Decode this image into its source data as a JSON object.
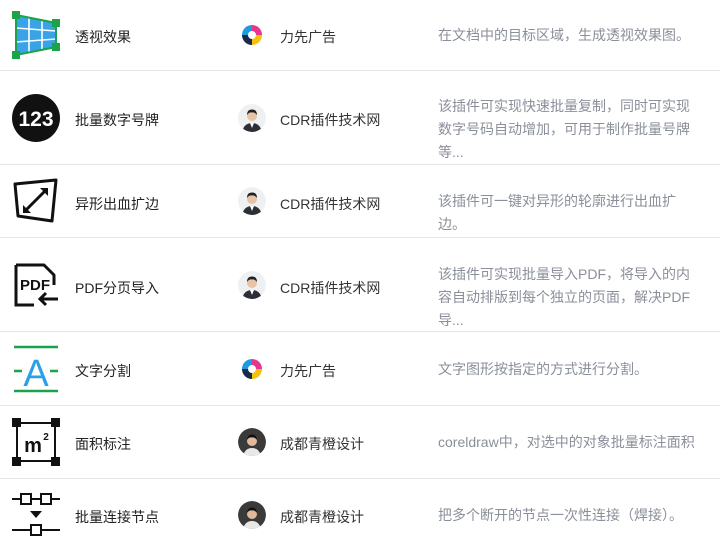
{
  "plugins": [
    {
      "icon": "perspective-grid-icon",
      "name": "透视效果",
      "author": "力先广告",
      "avatar": "logo-avatar",
      "desc": "在文档中的目标区域，生成透视效果图。"
    },
    {
      "icon": "number-123-icon",
      "name": "批量数字号牌",
      "author": "CDR插件技术网",
      "avatar": "person-avatar",
      "desc": "该插件可实现快速批量复制，同时可实现数字号码自动增加，可用于制作批量号牌等..."
    },
    {
      "icon": "bleed-expand-icon",
      "name": "异形出血扩边",
      "author": "CDR插件技术网",
      "avatar": "person-avatar",
      "desc": "该插件可一键对异形的轮廓进行出血扩边。"
    },
    {
      "icon": "pdf-import-icon",
      "name": "PDF分页导入",
      "author": "CDR插件技术网",
      "avatar": "person-avatar",
      "desc": "该插件可实现批量导入PDF，将导入的内容自动排版到每个独立的页面，解决PDF导..."
    },
    {
      "icon": "text-split-icon",
      "name": "文字分割",
      "author": "力先广告",
      "avatar": "logo-avatar",
      "desc": "文字图形按指定的方式进行分割。"
    },
    {
      "icon": "area-m2-icon",
      "name": "面积标注",
      "author": "成都青橙设计",
      "avatar": "person2-avatar",
      "desc": "coreldraw中，对选中的对象批量标注面积"
    },
    {
      "icon": "node-connect-icon",
      "name": "批量连接节点",
      "author": "成都青橙设计",
      "avatar": "person2-avatar",
      "desc": "把多个断开的节点一次性连接（焊接）。"
    }
  ],
  "colors": {
    "green": "#1aa34a",
    "blue": "#3aa3e8",
    "desc_gray": "#8a8f99"
  }
}
